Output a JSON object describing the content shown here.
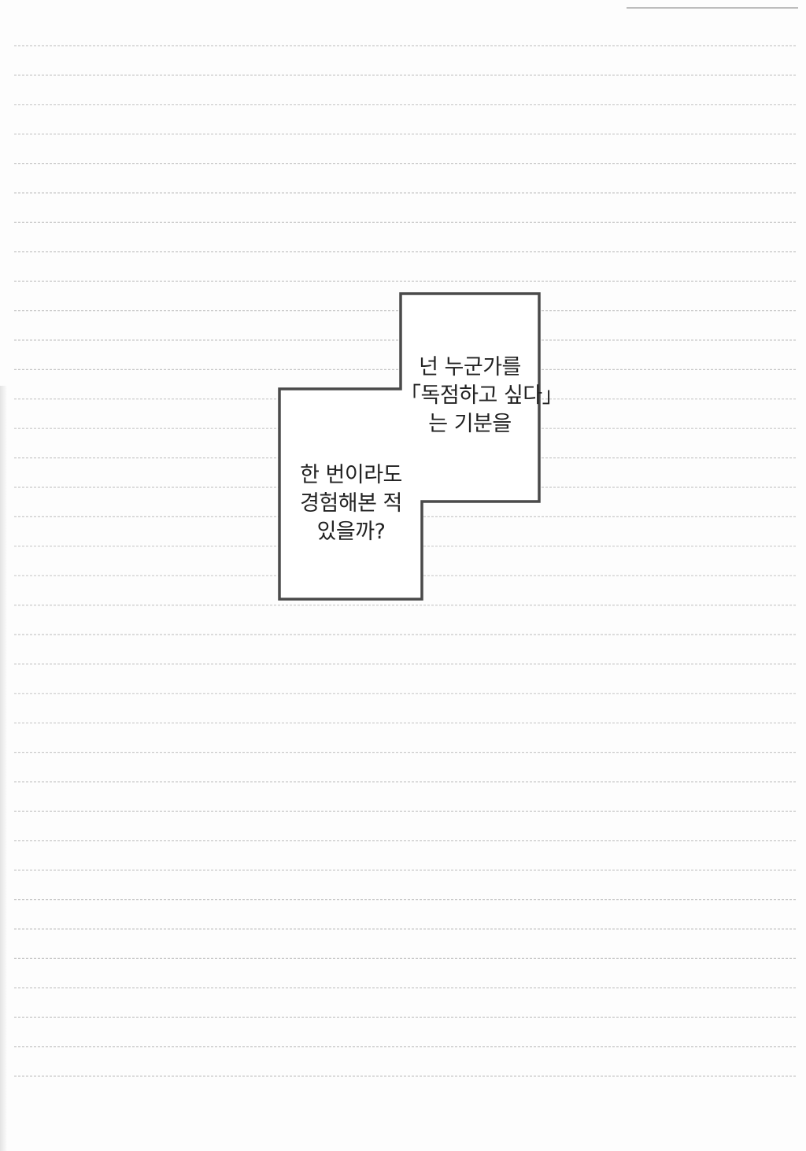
{
  "caption_top": {
    "lines": [
      "넌 누군가를",
      "「독점하고 싶다」",
      "는 기분을"
    ]
  },
  "caption_bottom": {
    "lines": [
      "한 번이라도",
      "경험해본 적",
      "있을까?"
    ]
  },
  "colors": {
    "paper": "#fdfdfd",
    "ruled_line": "#c9c9c9",
    "frame": "#4a4a4a",
    "text": "#222222"
  }
}
